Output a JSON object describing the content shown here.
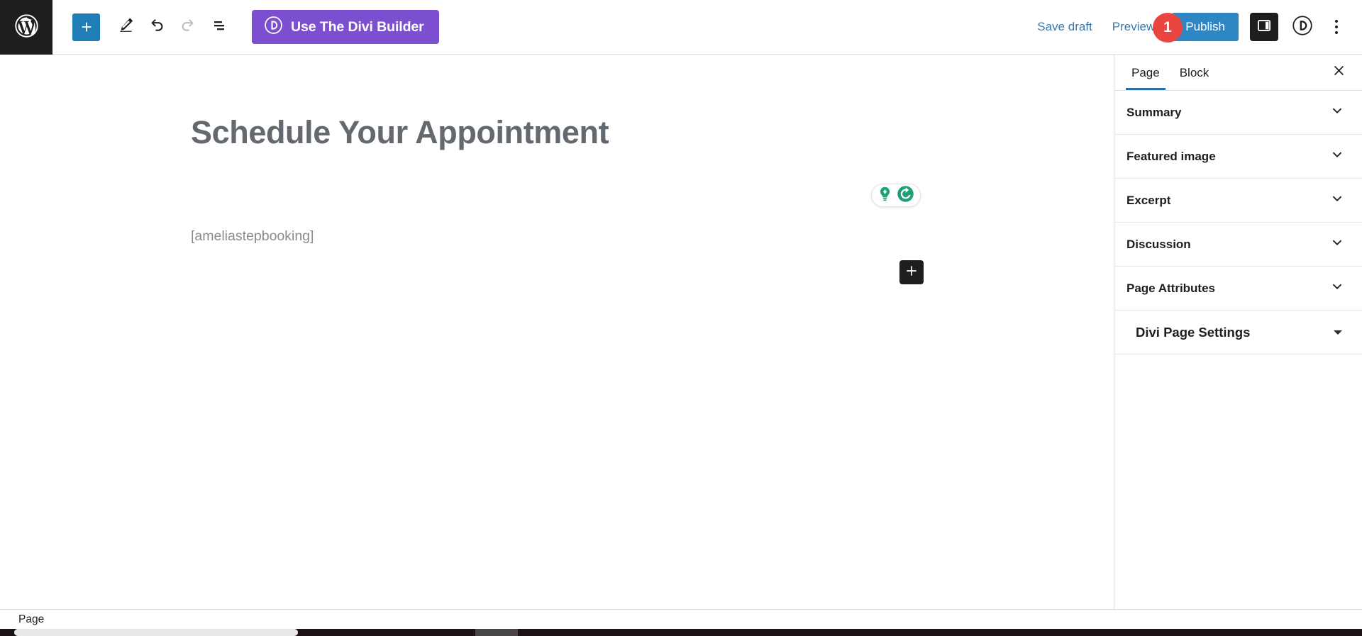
{
  "toolbar": {
    "wp_logo_icon": "wordpress-logo-icon",
    "add_block_label": "+",
    "add_block_icon": "plus-icon",
    "edit_tool_icon": "pencil-icon",
    "undo_icon": "undo-arrow-icon",
    "redo_icon": "redo-arrow-icon",
    "list_view_icon": "list-view-icon",
    "divi_builder_label": "Use The Divi Builder",
    "divi_builder_icon": "divi-circle-d-icon",
    "divi_builder_color": "#7b4fd0",
    "save_draft_label": "Save draft",
    "preview_label": "Preview",
    "notice_badge_count": "1",
    "notice_badge_color": "#e8463f",
    "publish_label": "Publish",
    "publish_color": "#2e87c4",
    "sidebar_toggle_icon": "settings-sidebar-icon",
    "divi_circle_icon": "divi-circle-d-icon",
    "more_options_icon": "three-dots-vertical-icon"
  },
  "editor": {
    "post_title": "Schedule Your Appointment",
    "shortcode_paragraph": "[ameliastepbooking]",
    "assist_pill": {
      "bulb_icon": "lightbulb-icon",
      "refresh_icon": "grammarly-refresh-icon",
      "accent_color": "#1f9d78"
    },
    "block_inserter_icon": "plus-icon"
  },
  "sidebar": {
    "tabs": [
      {
        "label": "Page",
        "active": true
      },
      {
        "label": "Block",
        "active": false
      }
    ],
    "close_icon": "close-icon",
    "active_tab_color": "#2e6fa3",
    "panels": [
      {
        "label": "Summary",
        "icon": "chevron-down-icon"
      },
      {
        "label": "Featured image",
        "icon": "chevron-down-icon"
      },
      {
        "label": "Excerpt",
        "icon": "chevron-down-icon"
      },
      {
        "label": "Discussion",
        "icon": "chevron-down-icon"
      },
      {
        "label": "Page Attributes",
        "icon": "chevron-down-icon"
      }
    ],
    "divi_panel": {
      "label": "Divi Page Settings",
      "icon": "caret-down-icon"
    }
  },
  "statusbar": {
    "breadcrumb": "Page"
  }
}
